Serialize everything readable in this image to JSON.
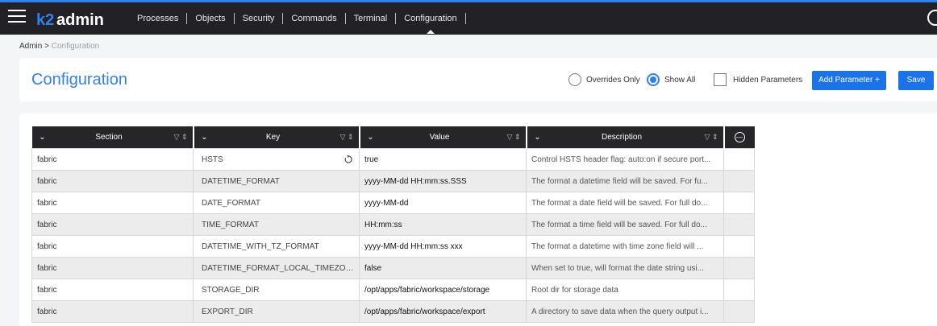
{
  "app": {
    "logo_text": "k2admin",
    "colors": {
      "accent": "#1a73e8",
      "title_blue": "#2f80ed",
      "nav_bg": "#212126",
      "header_bg": "#262629"
    }
  },
  "nav": {
    "items": [
      "Processes",
      "Objects",
      "Security",
      "Commands",
      "Terminal",
      "Configuration"
    ],
    "active": "Configuration"
  },
  "breadcrumb": {
    "root": "Admin",
    "separator": ">",
    "current": "Configuration"
  },
  "header": {
    "title": "Configuration",
    "radio_overrides": "Overrides Only",
    "radio_show_all": "Show All",
    "hidden_params": "Hidden Parameters",
    "add_button": "Add Parameter +",
    "save_button": "Save"
  },
  "table": {
    "columns": [
      "Section",
      "Key",
      "Value",
      "Description"
    ],
    "rows": [
      {
        "section": "fabric",
        "key": "HSTS",
        "value": "true",
        "description": "Control HSTS header flag: auto:on if secure port..."
      },
      {
        "section": "fabric",
        "key": "DATETIME_FORMAT",
        "value": "yyyy-MM-dd HH:mm:ss.SSS",
        "description": "The format a datetime field will be saved. For fu..."
      },
      {
        "section": "fabric",
        "key": "DATE_FORMAT",
        "value": "yyyy-MM-dd",
        "description": "The format a date field will be saved. For full do..."
      },
      {
        "section": "fabric",
        "key": "TIME_FORMAT",
        "value": "HH:mm:ss",
        "description": "The format a time field will be saved. For full do..."
      },
      {
        "section": "fabric",
        "key": "DATETIME_WITH_TZ_FORMAT",
        "value": "yyyy-MM-dd HH:mm:ss xxx",
        "description": "The format a datetime with time zone field will ..."
      },
      {
        "section": "fabric",
        "key": "DATETIME_FORMAT_LOCAL_TIMEZONE",
        "value": "false",
        "description": "When set to true, will format the date string usi..."
      },
      {
        "section": "fabric",
        "key": "STORAGE_DIR",
        "value": "/opt/apps/fabric/workspace/storage",
        "description": "Root dir for storage data"
      },
      {
        "section": "fabric",
        "key": "EXPORT_DIR",
        "value": "/opt/apps/fabric/workspace/export",
        "description": "A directory to save data when the query output i..."
      }
    ]
  }
}
